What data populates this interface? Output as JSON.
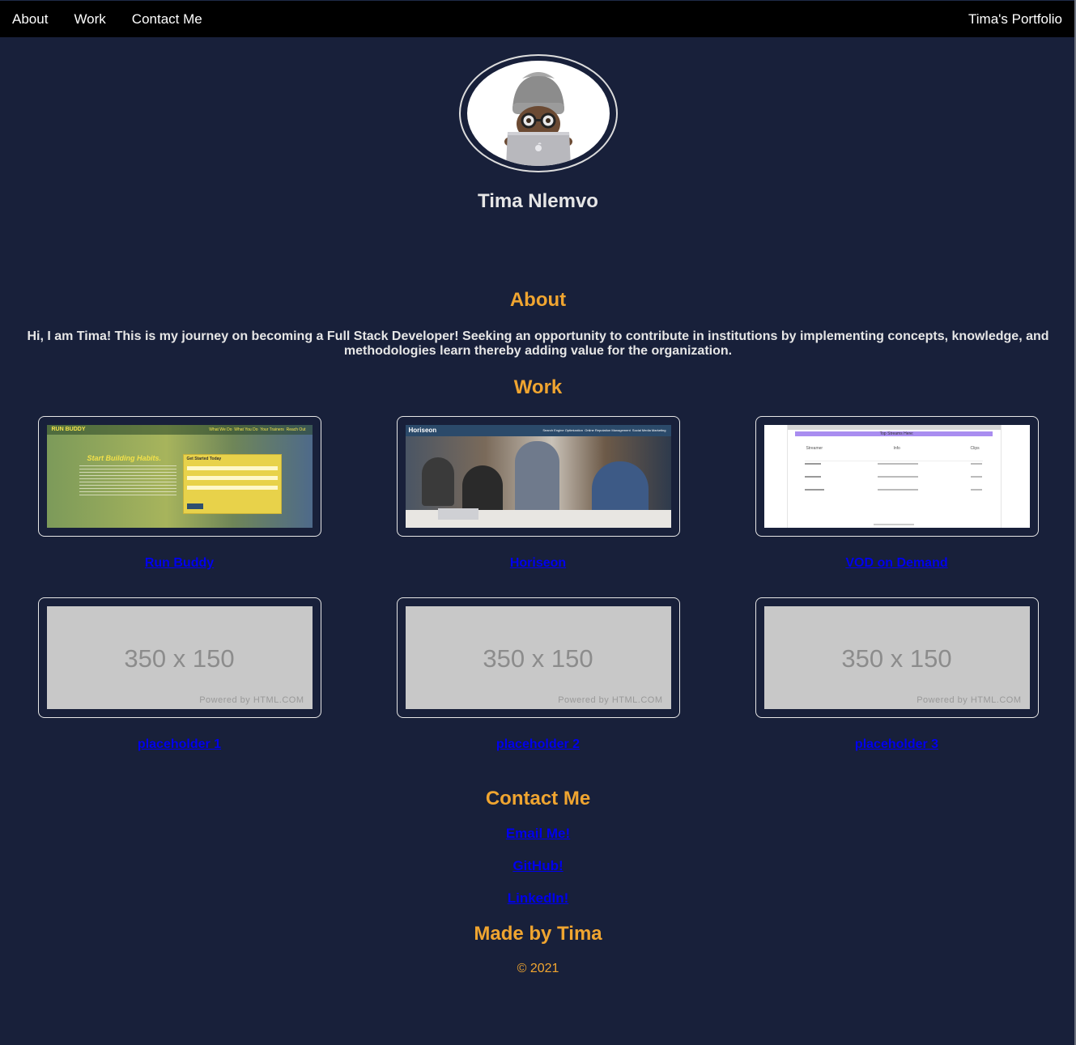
{
  "nav": {
    "links": [
      "About",
      "Work",
      "Contact Me"
    ],
    "brand": "Tima's Portfolio"
  },
  "header": {
    "name": "Tima Nlemvo",
    "avatar_icon": "memoji-laptop-avatar"
  },
  "about": {
    "title": "About",
    "text": "Hi, I am Tima! This is my journey on becoming a Full Stack Developer! Seeking an opportunity to contribute in institutions by implementing concepts, knowledge, and methodologies learn thereby adding value for the organization."
  },
  "work": {
    "title": "Work",
    "projects": [
      {
        "label": "Run Buddy",
        "thumb": "run-buddy-screenshot"
      },
      {
        "label": "Horiseon",
        "thumb": "horiseon-screenshot"
      },
      {
        "label": "VOD on Demand",
        "thumb": "vod-on-demand-screenshot"
      },
      {
        "label": "placeholder 1",
        "thumb": "placeholder"
      },
      {
        "label": "placeholder 2",
        "thumb": "placeholder"
      },
      {
        "label": "placeholder 3",
        "thumb": "placeholder"
      }
    ],
    "placeholder": {
      "size_text": "350 x 150",
      "powered_text": "Powered by HTML.COM"
    },
    "run_buddy": {
      "logo": "RUN BUDDY",
      "nav": [
        "What We Do",
        "What You Do",
        "Your Trainers",
        "Reach Out"
      ],
      "headline": "Start Building Habits.",
      "form_title": "Get Started Today"
    },
    "horiseon": {
      "logo": "Horiseon",
      "nav": [
        "Search Engine Optimization",
        "Online Reputation Management",
        "Social Media Marketing"
      ]
    },
    "vod": {
      "banner": "Top Streams Here:",
      "columns": [
        "Streamer",
        "Info",
        "Clips"
      ]
    }
  },
  "contact": {
    "title": "Contact Me",
    "links": [
      "Email Me!",
      "GitHub!",
      "LinkedIn!"
    ]
  },
  "footer": {
    "title": "Made by Tima",
    "copyright": "© 2021"
  },
  "colors": {
    "background": "#18203a",
    "accent": "#f0a530",
    "link": "#0000ee",
    "navbar": "#000000"
  }
}
